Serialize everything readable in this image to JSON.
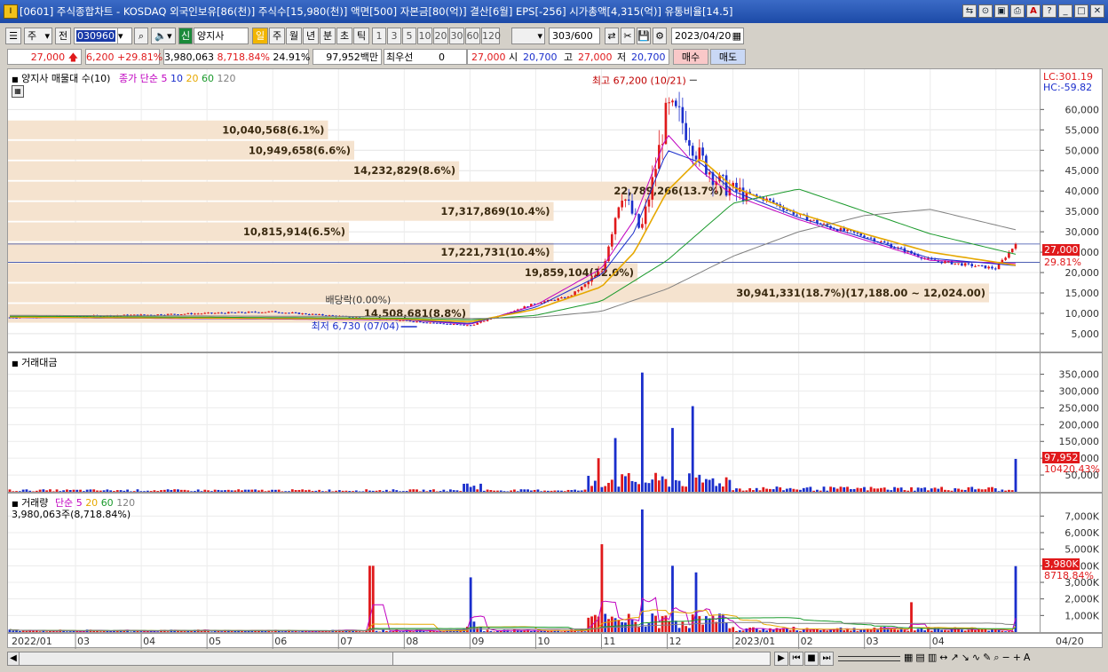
{
  "window": {
    "title": "[0601] 주식종합차트 - KOSDAQ 외국인보유[86(천)] 주식수[15,980(천)] 액면[500] 자본금[80(억)] 결산[6월] EPS[-256] 시가총액[4,315(억)] 유통비율[14.5]"
  },
  "toolbar": {
    "market": "주",
    "prev_label": "전",
    "code": "030960",
    "name_tag": "신",
    "name": "양지사",
    "periods": [
      "일",
      "주",
      "월",
      "년",
      "분",
      "초",
      "틱"
    ],
    "minutes": [
      "1",
      "3",
      "5",
      "10",
      "20",
      "30",
      "60",
      "120"
    ],
    "count": "303",
    "count_total": "/600",
    "date": "2023/04/20"
  },
  "info": {
    "price": "27,000",
    "change": "6,200",
    "change_pct": "+29.81%",
    "volume": "3,980,063",
    "vol_ratio": "8,718.84%",
    "turnover": "24.91%",
    "amount": "97,952백만",
    "pref_label": "최우선",
    "pref_value": "0",
    "best_price": "27,000",
    "open_label": "시",
    "open": "20,700",
    "high_label": "고",
    "high": "27,000",
    "low_label": "저",
    "low": "20,700",
    "buy_label": "매수",
    "sell_label": "매도"
  },
  "price_panel": {
    "legend_name": "양지사 매물대 수(10)",
    "legend_ma": "종가 단순",
    "ma_periods": [
      "5",
      "10",
      "20",
      "60",
      "120"
    ],
    "lc": "LC:301.19",
    "hc": "HC:-59.82",
    "high_note": "최고 67,200 (10/21)",
    "low_note": "최저 6,730 (07/04)",
    "dividend_note": "배당락(0.00%)",
    "price_tag": "27,000",
    "pct_tag": "29.81%"
  },
  "amount_panel": {
    "legend": "거래대금",
    "tag1": "97,952",
    "tag2": "10420.43%"
  },
  "volume_panel": {
    "legend": "거래량",
    "legend_ma": "단순",
    "ma_periods": [
      "5",
      "20",
      "60",
      "120"
    ],
    "sub": "3,980,063주(8,718.84%)",
    "tag1": "3,980K",
    "tag2": "8718.84%"
  },
  "colors": {
    "up": "#e0191b",
    "down": "#1a2ecc",
    "ma5": "#c000c0",
    "ma10": "#1a2ecc",
    "ma20": "#e6a800",
    "ma60": "#1b9a2c",
    "ma120": "#808080",
    "profile": "#f5e3cf"
  },
  "chart_data": {
    "type": "candlestick",
    "x_ticks": [
      "2022/01",
      "03",
      "04",
      "05",
      "06",
      "07",
      "08",
      "09",
      "10",
      "11",
      "12",
      "2023/01",
      "02",
      "03",
      "04",
      "04/20"
    ],
    "price_axis": [
      "60,000",
      "55,000",
      "50,000",
      "45,000",
      "40,000",
      "35,000",
      "30,000",
      "25,000",
      "20,000",
      "15,000",
      "10,000",
      "5,000"
    ],
    "price_range": [
      1500,
      69000
    ],
    "series": [
      {
        "name": "종가",
        "x": [
          0,
          2,
          4,
          6,
          7,
          8,
          8.5,
          9,
          9.3,
          9.6,
          9.8,
          10,
          10.2,
          10.5,
          10.8,
          11,
          11.5,
          12,
          12.5,
          13,
          13.5,
          14,
          14.5,
          15,
          15.3
        ],
        "values": [
          9000,
          9600,
          10400,
          8200,
          7000,
          12500,
          14000,
          20000,
          40000,
          30000,
          44000,
          60000,
          58000,
          48000,
          42000,
          40000,
          38000,
          34000,
          31000,
          29000,
          26000,
          23000,
          22000,
          21000,
          27000
        ]
      },
      {
        "name": "5",
        "x": [
          0,
          6,
          7,
          8,
          9,
          9.5,
          10,
          10.5,
          11,
          12,
          13,
          14,
          15.3
        ],
        "values": [
          9000,
          8400,
          7300,
          12000,
          21000,
          33000,
          54000,
          45000,
          39000,
          33000,
          28000,
          23000,
          22200
        ]
      },
      {
        "name": "10",
        "x": [
          0,
          6,
          7,
          8,
          9,
          9.5,
          10,
          10.5,
          11,
          12,
          13,
          14,
          15.3
        ],
        "values": [
          9000,
          8500,
          7500,
          11500,
          19500,
          30000,
          50000,
          47000,
          40000,
          33500,
          28500,
          23500,
          21700
        ]
      },
      {
        "name": "20",
        "x": [
          0,
          6,
          7,
          8,
          9,
          9.5,
          10,
          10.5,
          11,
          12,
          13,
          14,
          15.3
        ],
        "values": [
          9100,
          8600,
          7900,
          11000,
          16500,
          25000,
          40000,
          48000,
          41000,
          34500,
          29500,
          25000,
          21800
        ]
      },
      {
        "name": "60",
        "x": [
          0,
          6,
          7,
          8,
          9,
          10,
          11,
          12,
          13,
          14,
          15.3
        ],
        "values": [
          9300,
          8800,
          8400,
          9500,
          13000,
          23000,
          37000,
          40500,
          35000,
          29500,
          24500
        ]
      },
      {
        "name": "120",
        "x": [
          0,
          6,
          7,
          8,
          9,
          10,
          11,
          12,
          13,
          14,
          15.3
        ],
        "values": [
          9500,
          9200,
          8700,
          9000,
          10500,
          16000,
          24000,
          30000,
          34000,
          35500,
          30500
        ]
      }
    ],
    "volume_profile": [
      {
        "label": "10,040,568(6.1%)",
        "price": 55000,
        "share": 6.1
      },
      {
        "label": "10,949,658(6.6%)",
        "price": 50000,
        "share": 6.6
      },
      {
        "label": "14,232,829(8.6%)",
        "price": 45000,
        "share": 8.6
      },
      {
        "label": "22,789,266(13.7%)",
        "price": 40000,
        "share": 13.7
      },
      {
        "label": "17,317,869(10.4%)",
        "price": 35000,
        "share": 10.4
      },
      {
        "label": "10,815,914(6.5%)",
        "price": 30000,
        "share": 6.5
      },
      {
        "label": "17,221,731(10.4%)",
        "price": 25000,
        "share": 10.4
      },
      {
        "label": "19,859,104(12.0%)",
        "price": 20000,
        "share": 12.0
      },
      {
        "label": "30,941,331(18.7%)(17,188.00 ~ 12,024.00)",
        "price": 15000,
        "share": 18.7
      },
      {
        "label": "14,508,681(8.8%)",
        "price": 10000,
        "share": 8.8
      }
    ],
    "amount_axis": [
      "350,000",
      "300,000",
      "250,000",
      "200,000",
      "150,000",
      "100,000",
      "50,000"
    ],
    "amount_range": [
      0,
      370000
    ],
    "volume_axis": [
      "7,000K",
      "6,000K",
      "5,000K",
      "4,000K",
      "3,000K",
      "2,000K",
      "1,000K"
    ],
    "volume_range": [
      0,
      7500
    ]
  }
}
